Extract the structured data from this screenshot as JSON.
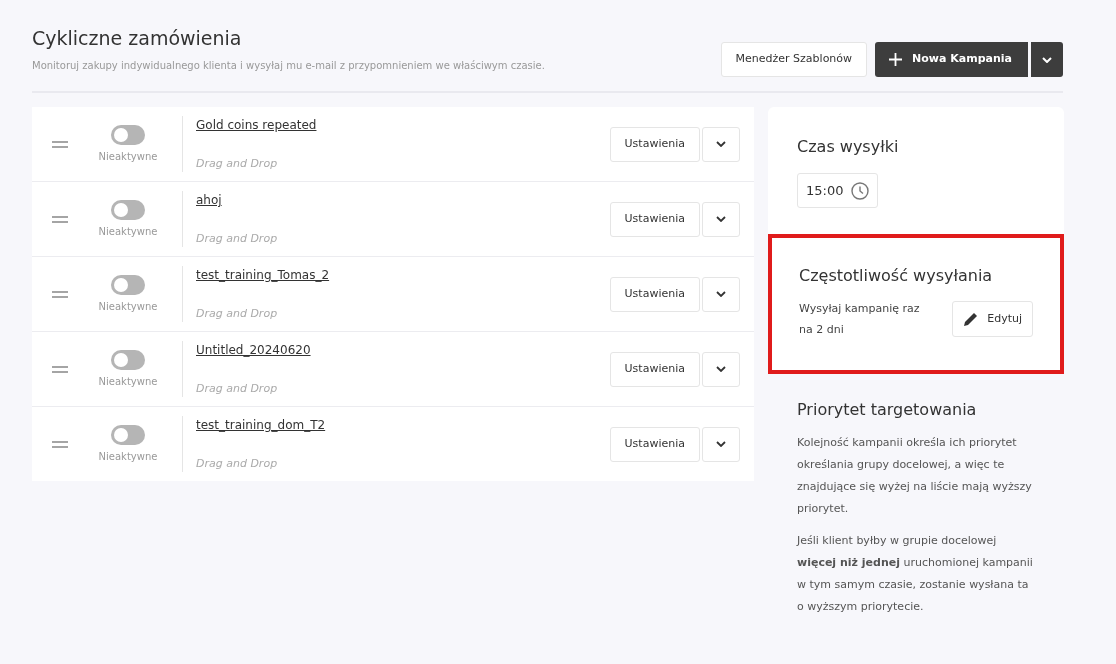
{
  "header": {
    "title": "Cykliczne zamówienia",
    "subtitle": "Monitoruj zakupy indywidualnego klienta i wysyłaj mu e-mail z przypomnieniem we właściwym czasie.",
    "template_button": "Menedżer Szablonów",
    "new_button": "Nowa Kampania"
  },
  "campaigns": [
    {
      "name": "Gold coins repeated",
      "type": "Drag and Drop",
      "status": "Nieaktywne",
      "on": false,
      "settings": "Ustawienia"
    },
    {
      "name": "ahoj",
      "type": "Drag and Drop",
      "status": "Nieaktywne",
      "on": false,
      "settings": "Ustawienia"
    },
    {
      "name": "test_training_Tomas_2",
      "type": "Drag and Drop",
      "status": "Nieaktywne",
      "on": false,
      "settings": "Ustawienia"
    },
    {
      "name": "Untitled_20240620",
      "type": "Drag and Drop",
      "status": "Nieaktywne",
      "on": false,
      "settings": "Ustawienia"
    },
    {
      "name": "test_training_dom_T2",
      "type": "Drag and Drop",
      "status": "Nieaktywne",
      "on": false,
      "settings": "Ustawienia"
    }
  ],
  "send_time": {
    "title": "Czas wysyłki",
    "value": "15:00"
  },
  "frequency": {
    "title": "Częstotliwość wysyłania",
    "text": "Wysyłaj kampanię raz na 2 dni",
    "edit_button": "Edytuj",
    "highlighted": true
  },
  "priority": {
    "title": "Priorytet targetowania",
    "paragraphs": [
      "Kolejność kampanii określa ich priorytet określania grupy docelowej, a więc te znajdujące się wyżej na liście mają wyższy priorytet.",
      "Jeśli klient byłby w grupie docelowej **więcej niż jednej** uruchomionej kampanii w tym samym czasie, zostanie wysłana ta o wyższym priorytecie."
    ]
  }
}
